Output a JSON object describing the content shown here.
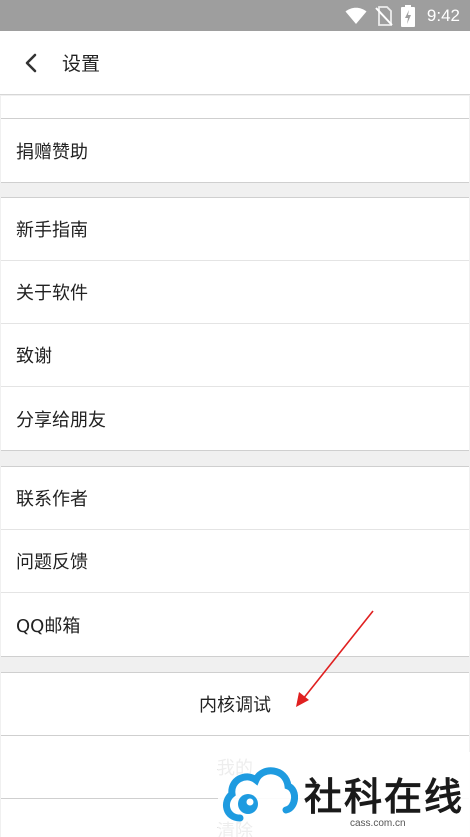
{
  "status_bar": {
    "time": "9:42",
    "icons": [
      "wifi-icon",
      "no-sim-icon",
      "battery-charging-icon"
    ]
  },
  "header": {
    "title": "设置",
    "back_icon": "chevron-left-icon"
  },
  "groups": [
    {
      "items": [
        "捐赠赞助"
      ]
    },
    {
      "items": [
        "新手指南",
        "关于软件",
        "致谢",
        "分享给朋友"
      ]
    },
    {
      "items": [
        "联系作者",
        "问题反馈",
        "QQ邮箱"
      ]
    },
    {
      "items": [
        "内核调试",
        "我的",
        "清除"
      ]
    }
  ],
  "annotation": {
    "arrow_color": "#e02020"
  },
  "watermark": {
    "text": "社科在线",
    "url": "cass.com.cn",
    "logo_color": "#1e9be0"
  }
}
